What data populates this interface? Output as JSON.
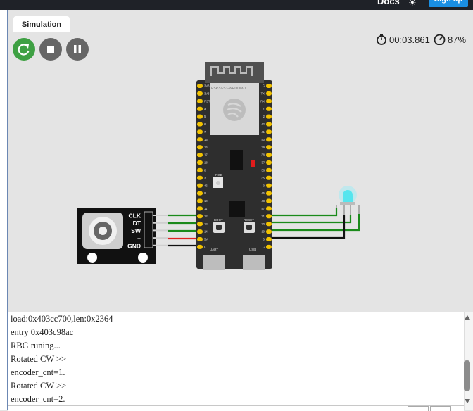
{
  "header": {
    "docs_label": "Docs",
    "signup_label": "Sign up",
    "theme_icon": "sun-icon"
  },
  "tabs": [
    {
      "label": "Simulation"
    }
  ],
  "controls": {
    "restart_icon": "restart-icon",
    "stop_icon": "stop-icon",
    "pause_icon": "pause-icon",
    "restart_color": "#3ea043",
    "button_color": "#666666"
  },
  "status": {
    "timer": "00:03.861",
    "speed": "87%"
  },
  "board": {
    "module_label": "ESP32-S3-WROOM-1",
    "left_pins": [
      "3V3",
      "3V3",
      "RST",
      "4",
      "5",
      "6",
      "7",
      "15",
      "16",
      "17",
      "18",
      "8",
      "3",
      "46",
      "9",
      "10",
      "11",
      "12",
      "13",
      "14",
      "5V",
      "G"
    ],
    "right_pins": [
      "G",
      "TX",
      "RX",
      "1",
      "2",
      "42",
      "41",
      "40",
      "39",
      "38",
      "37",
      "36",
      "35",
      "0",
      "45",
      "48",
      "47",
      "21",
      "20",
      "19",
      "G",
      "G"
    ],
    "rgb_label": "RGB",
    "boot_label": "BOOT",
    "reset_label": "RESET",
    "uart_label": "UART",
    "usb_label": "USB"
  },
  "encoder": {
    "pins": [
      "CLK",
      "DT",
      "SW",
      "+",
      "GND"
    ]
  },
  "console": {
    "lines": [
      "load:0x403cc700,len:0x2364",
      "entry 0x403c98ac",
      "RBG runing...",
      "Rotated CW >>",
      "encoder_cnt=1.",
      "Rotated CW >>",
      "encoder_cnt=2."
    ]
  }
}
